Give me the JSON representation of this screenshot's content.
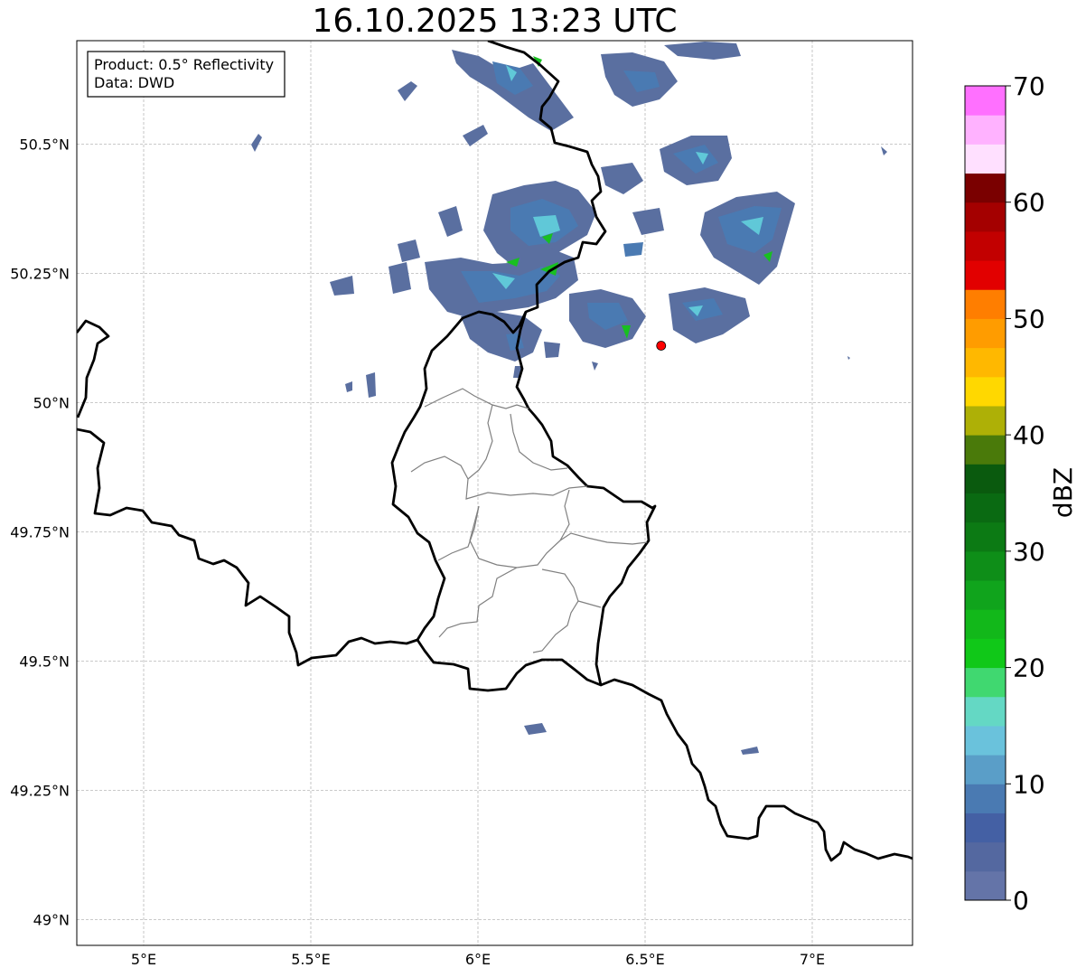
{
  "title": "16.10.2025 13:23 UTC",
  "info_box": {
    "product_line": "Product: 0.5° Reflectivity",
    "data_line": "Data: DWD"
  },
  "map": {
    "lon_range": [
      4.8,
      7.3
    ],
    "lat_range": [
      48.95,
      50.7
    ],
    "lon_ticks": [
      {
        "value": 5.0,
        "label": "5°E"
      },
      {
        "value": 5.5,
        "label": "5.5°E"
      },
      {
        "value": 6.0,
        "label": "6°E"
      },
      {
        "value": 6.5,
        "label": "6.5°E"
      },
      {
        "value": 7.0,
        "label": "7°E"
      }
    ],
    "lat_ticks": [
      {
        "value": 50.5,
        "label": "50.5°N"
      },
      {
        "value": 50.25,
        "label": "50.25°N"
      },
      {
        "value": 50.0,
        "label": "50°N"
      },
      {
        "value": 49.75,
        "label": "49.75°N"
      },
      {
        "value": 49.5,
        "label": "49.5°N"
      },
      {
        "value": 49.25,
        "label": "49.25°N"
      },
      {
        "value": 49.0,
        "label": "49°N"
      }
    ],
    "gridlines": true,
    "radar_site": {
      "lon": 6.548,
      "lat": 50.11,
      "color": "#ff0000"
    },
    "echo_colors": {
      "weak": "#5a6fa0",
      "light": "#4a7ab2",
      "moderate": "#60c8d8",
      "strong": "#18c020"
    }
  },
  "colorbar": {
    "label": "dBZ",
    "range": [
      0,
      70
    ],
    "step": 2.5,
    "ticks": [
      {
        "value": 0,
        "label": "0"
      },
      {
        "value": 10,
        "label": "10"
      },
      {
        "value": 20,
        "label": "20"
      },
      {
        "value": 30,
        "label": "30"
      },
      {
        "value": 40,
        "label": "40"
      },
      {
        "value": 50,
        "label": "50"
      },
      {
        "value": 60,
        "label": "60"
      },
      {
        "value": 70,
        "label": "70"
      }
    ],
    "colors": [
      "#6474a8",
      "#5468a0",
      "#4460a4",
      "#4a7ab2",
      "#5a9ec8",
      "#6ac2dc",
      "#64d8c4",
      "#40d870",
      "#10c818",
      "#12b81a",
      "#10a41c",
      "#0e8e18",
      "#0c7a14",
      "#0a6a12",
      "#0a5a0e",
      "#4a7a0a",
      "#aeb006",
      "#ffd800",
      "#ffb800",
      "#ff9c00",
      "#ff7e00",
      "#e20000",
      "#c20000",
      "#a40000",
      "#7a0000",
      "#ffe0ff",
      "#ffb2ff",
      "#ff70ff",
      "#ee34ee"
    ]
  }
}
